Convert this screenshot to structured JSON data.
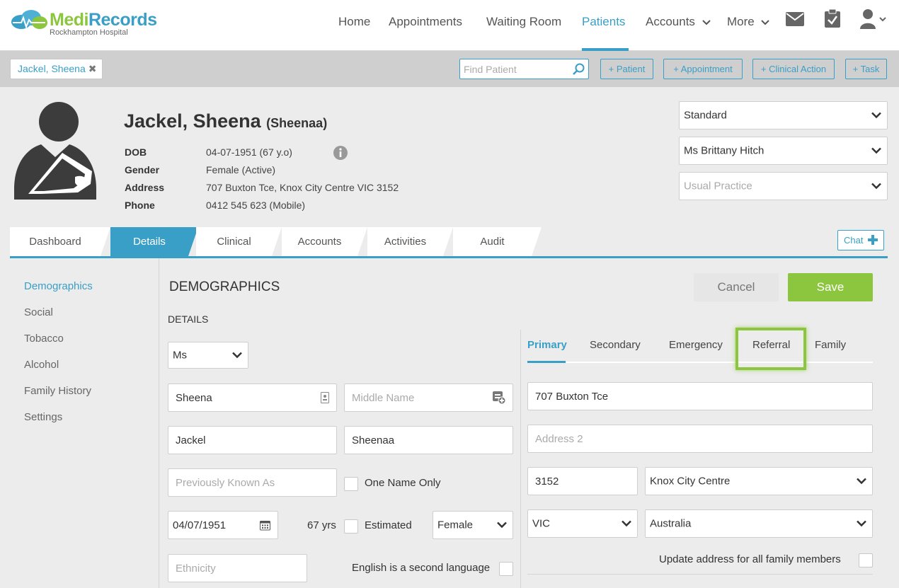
{
  "header": {
    "logo_medi": "Medi",
    "logo_records": "Records",
    "logo_sub": "Rockhampton Hospital",
    "nav": [
      {
        "label": "Home"
      },
      {
        "label": "Appointments"
      },
      {
        "label": "Waiting Room"
      },
      {
        "label": "Patients",
        "active": true
      },
      {
        "label": "Accounts",
        "dropdown": true
      },
      {
        "label": "More",
        "dropdown": true
      }
    ],
    "icons": [
      "mail-icon",
      "clipboard-icon",
      "user-icon"
    ]
  },
  "actionbar": {
    "patient_chip": "Jackel, Sheena",
    "find_placeholder": "Find Patient",
    "buttons": [
      "+ Patient",
      "+ Appointment",
      "+ Clinical Action",
      "+ Task"
    ]
  },
  "patient": {
    "name": "Jackel, Sheena",
    "alias": "(Sheenaa)",
    "labels": {
      "dob": "DOB",
      "gender": "Gender",
      "address": "Address",
      "phone": "Phone"
    },
    "dob": "04-07-1951 (67 y.o)",
    "gender": "Female (Active)",
    "address": "707 Buxton Tce, Knox City Centre VIC 3152",
    "phone": "0412 545 623 (Mobile)"
  },
  "header_selects": {
    "type": "Standard",
    "practitioner": "Ms Brittany Hitch",
    "practice_placeholder": "Usual Practice"
  },
  "tabs": [
    {
      "label": "Dashboard"
    },
    {
      "label": "Details",
      "active": true
    },
    {
      "label": "Clinical"
    },
    {
      "label": "Accounts"
    },
    {
      "label": "Activities"
    },
    {
      "label": "Audit"
    }
  ],
  "chat_label": "Chat",
  "sidebar": {
    "items": [
      {
        "label": "Demographics",
        "active": true
      },
      {
        "label": "Social"
      },
      {
        "label": "Tobacco"
      },
      {
        "label": "Alcohol"
      },
      {
        "label": "Family History"
      },
      {
        "label": "Settings"
      }
    ]
  },
  "demographics": {
    "title": "DEMOGRAPHICS",
    "details_title": "DETAILS",
    "cancel_label": "Cancel",
    "save_label": "Save",
    "title_select": "Ms",
    "first_name": "Sheena",
    "middle_name_placeholder": "Middle Name",
    "last_name": "Jackel",
    "preferred_name": "Sheenaa",
    "previously_known_placeholder": "Previously Known As",
    "one_name_only_label": "One Name Only",
    "dob_value": "04/07/1951",
    "age_label": "67 yrs",
    "estimated_label": "Estimated",
    "sex_select": "Female",
    "ethnicity_placeholder": "Ethnicity",
    "english_second_label": "English is a second language"
  },
  "address": {
    "tabs": [
      {
        "label": "Primary",
        "active": true
      },
      {
        "label": "Secondary"
      },
      {
        "label": "Emergency"
      },
      {
        "label": "Referral",
        "highlighted": true
      },
      {
        "label": "Family"
      }
    ],
    "line1": "707 Buxton Tce",
    "line2_placeholder": "Address 2",
    "postcode": "3152",
    "suburb": "Knox City Centre",
    "state": "VIC",
    "country": "Australia",
    "update_family_label": "Update address for all family members"
  },
  "colors": {
    "accent": "#3a9fc6",
    "brand_green": "#8cc63f",
    "highlight": "#8cc63f"
  }
}
